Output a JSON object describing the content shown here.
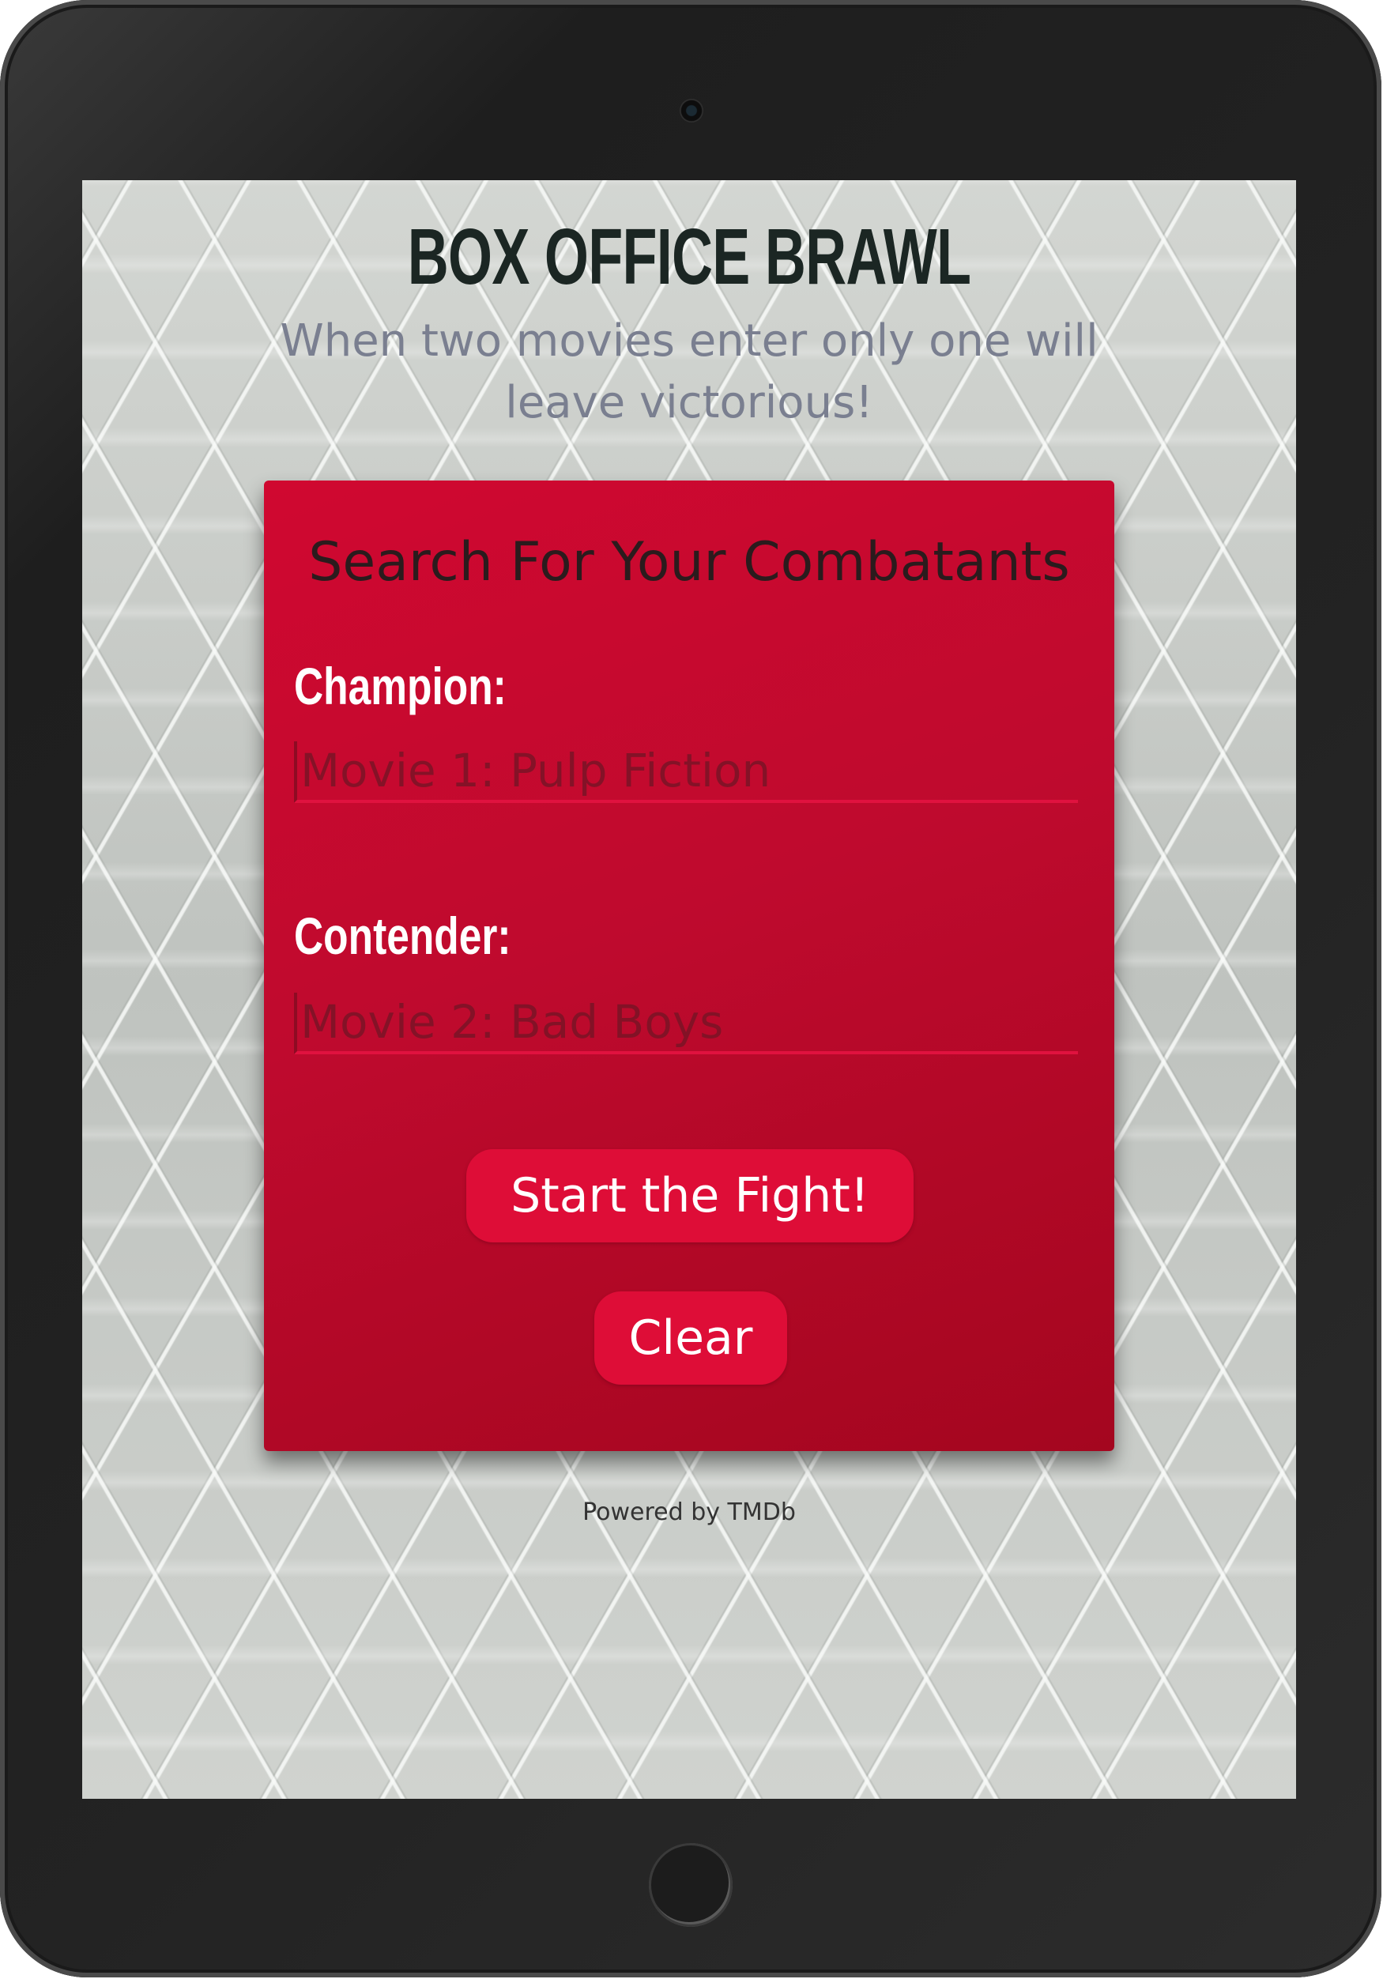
{
  "app": {
    "title": "BOX OFFICE BRAWL",
    "tagline": "When two movies enter only one will leave victorious!"
  },
  "search_card": {
    "heading": "Search For Your Combatants",
    "champion": {
      "label": "Champion:",
      "placeholder": "Movie 1: Pulp Fiction",
      "value": ""
    },
    "contender": {
      "label": "Contender:",
      "placeholder": "Movie 2: Bad Boys",
      "value": ""
    },
    "start_button_label": "Start the Fight!",
    "clear_button_label": "Clear"
  },
  "footer": {
    "powered_by": "Powered by TMDb"
  },
  "colors": {
    "card_red": "#c80a2f",
    "button_red": "#de0d37",
    "title_dark": "#1b2623",
    "tagline_gray": "#7a7f90",
    "device_black": "#232323"
  },
  "icons": {
    "camera": "camera-icon",
    "home_button": "home-button-icon"
  }
}
